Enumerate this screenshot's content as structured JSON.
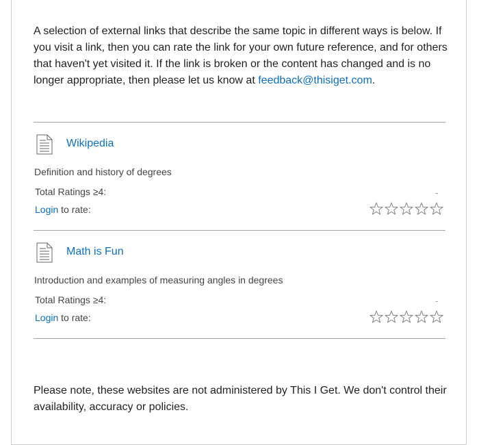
{
  "intro": {
    "text": "A selection of external links that describe the same topic in different ways is below. If you visit a link, then you can rate the link for your own future reference, and for others that haven't yet visited it. If the link is broken or the content has changed and is no longer appropriate, then please let us know at ",
    "email": "feedback@thisiget.com",
    "suffix": "."
  },
  "entries": [
    {
      "title": "Wikipedia",
      "description": "Definition and history of degrees",
      "ratings_label": "Total Ratings ≥4:",
      "ratings_value": "-",
      "login_label": "Login",
      "rate_suffix": " to rate:",
      "stars": 5
    },
    {
      "title": "Math is Fun",
      "description": "Introduction and examples of measuring angles in degrees",
      "ratings_label": "Total Ratings ≥4:",
      "ratings_value": "-",
      "login_label": "Login",
      "rate_suffix": " to rate:",
      "stars": 5
    }
  ],
  "note": {
    "text": "Please note, these websites are not administered by This I Get. We don't control their availability, accuracy or policies."
  },
  "colors": {
    "link": "#0b6ec5",
    "rule": "#a6a6a6",
    "star_outline": "#8a8a8a"
  },
  "icons": {
    "document": "document-icon",
    "star": "star-outline-icon"
  }
}
